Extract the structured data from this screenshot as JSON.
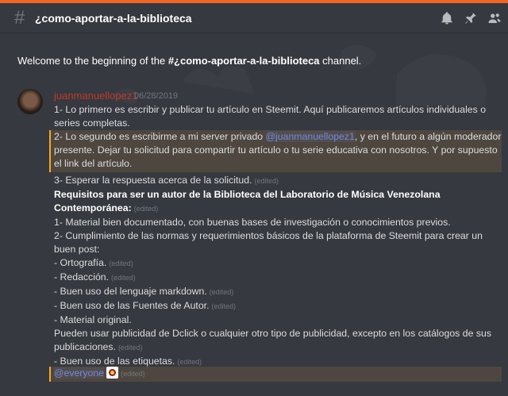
{
  "channel": {
    "title": "¿como-aportar-a-la-biblioteca"
  },
  "welcome": {
    "prefix": "Welcome to the beginning of the ",
    "channel": "#¿como-aportar-a-la-biblioteca",
    "suffix": " channel."
  },
  "message": {
    "author": "juanmanuellopez1",
    "timestamp": "06/28/2019",
    "p1": "1- Lo primero es escribir y publicar tu artículo en Steemit. Aquí publicaremos artículos individuales o series completas.",
    "p2_before": "2- Lo segundo es escribirme a mi server privado ",
    "p2_mention": "@juanmanuellopez1",
    "p2_after": ", y en el futuro a algún moderador presente. Dejar tu solicitud para compartir tu artículo o tu serie  educativa con nosotros. Y por supuesto el link del artículo.",
    "p3": "3- Esperar la respuesta acerca de la solicitud.",
    "req_title": "Requisitos para ser un autor de la Biblioteca del Laboratorio de Música Venezolana Contemporánea:",
    "r1": "1- Material bien documentado, con buenas bases de investigación o conocimientos previos.",
    "r2": "2- Cumplimiento de las normas y requerimientos básicos de la plataforma de Steemit para crear un buen post:",
    "b1": "- Ortografía.",
    "b2": "- Redacción.",
    "b3": "- Buen uso del lenguaje markdown.",
    "b4": "- Buen uso de las Fuentes de Autor.",
    "b5": "- Material original.",
    "b6": " Pueden usar publicidad de Dclick o cualquier otro tipo de publicidad, excepto en los catálogos de sus publicaciones.",
    "b7": "- Buen uso de las etiquetas.",
    "everyone": "@everyone",
    "edited": "(edited)"
  }
}
